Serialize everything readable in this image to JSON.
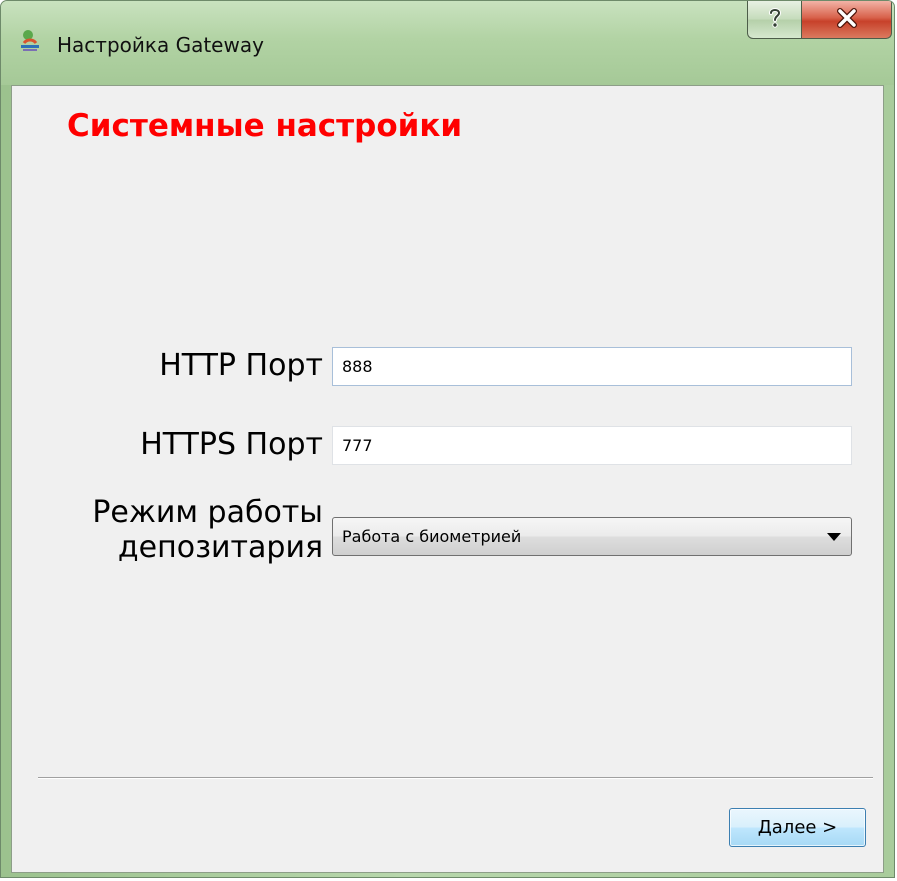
{
  "window": {
    "title": "Настройка Gateway",
    "app_icon": "gateway-app-icon",
    "help_icon": "question-icon",
    "close_icon": "close-x-icon"
  },
  "page": {
    "title": "Системные настройки"
  },
  "fields": {
    "http_port": {
      "label": "HTTP Порт",
      "value": "888"
    },
    "https_port": {
      "label": "HTTPS Порт",
      "value": "777"
    },
    "mode": {
      "label_line1": "Режим работы",
      "label_line2": "депозитария",
      "selected": "Работа с биометрией",
      "icon": "dropdown-arrow-icon"
    }
  },
  "footer": {
    "next_button": {
      "mnemonic": "Д",
      "label_rest": "алее >"
    }
  },
  "colors": {
    "page_title": "#ff0000",
    "client_background": "#f0f0f0",
    "titlebar_green": "#b2d3a4",
    "close_red": "#c7412a",
    "button_blue": "#bee6fd"
  }
}
